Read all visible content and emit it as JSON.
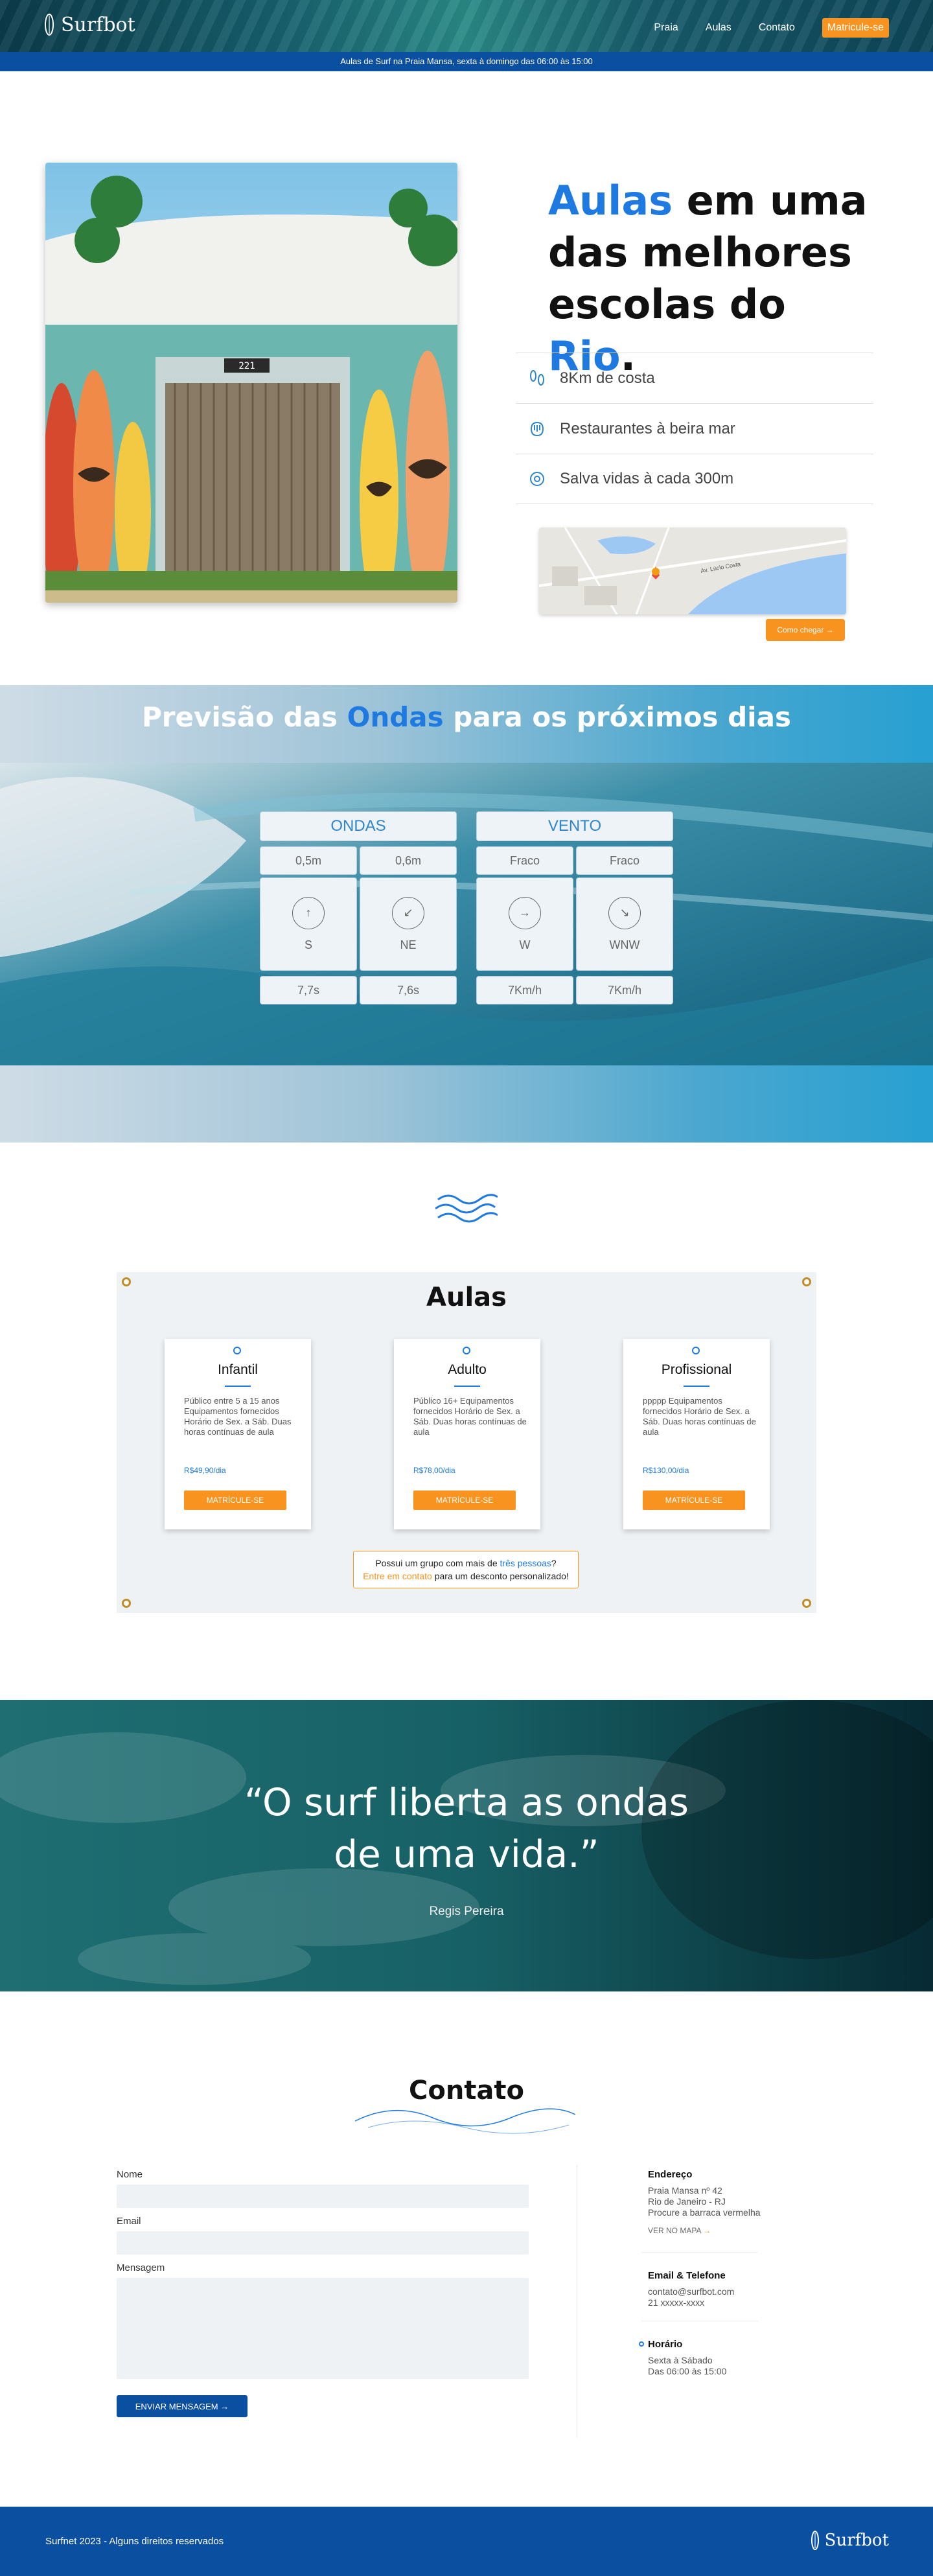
{
  "header": {
    "logo_text": "Surfbot",
    "nav": [
      "Praia",
      "Aulas",
      "Contato"
    ],
    "cta": "Matricule-se"
  },
  "topbar": {
    "text": "Aulas de Surf na Praia Mansa, sexta à domingo das 06:00 às 15:00"
  },
  "hero": {
    "title_part1": "Aulas",
    "title_part2": " em uma das melhores escolas do ",
    "title_part3": "Rio",
    "title_part4": ".",
    "house_number": "221",
    "features": [
      {
        "icon": "footprints-icon",
        "label": "8Km de costa"
      },
      {
        "icon": "food-icon",
        "label": "Restaurantes à beira mar"
      },
      {
        "icon": "lifebuoy-icon",
        "label": "Salva vidas à cada 300m"
      }
    ],
    "map_button": "Como chegar →",
    "map_street": "Av. Lúcio Costa"
  },
  "forecast": {
    "title_part1": "Previsão das ",
    "title_part2": "Ondas",
    "title_part3": " para os próximos dias",
    "ondas": {
      "title": "ONDAS",
      "heights": [
        "0,5m",
        "0,6m"
      ],
      "directions": [
        {
          "arrow": "↑",
          "label": "S"
        },
        {
          "arrow": "↙",
          "label": "NE"
        }
      ],
      "periods": [
        "7,7s",
        "7,6s"
      ]
    },
    "vento": {
      "title": "VENTO",
      "strengths": [
        "Fraco",
        "Fraco"
      ],
      "directions": [
        {
          "arrow": "→",
          "label": "W"
        },
        {
          "arrow": "↘",
          "label": "WNW"
        }
      ],
      "speeds": [
        "7Km/h",
        "7Km/h"
      ]
    }
  },
  "aulas": {
    "title": "Aulas",
    "cards": [
      {
        "title": "Infantil",
        "desc": "Público entre 5 a 15 anos Equipamentos fornecidos Horário de Sex. a Sáb. Duas horas contínuas de aula",
        "price": "R$49,90/dia",
        "button": "MATRÍCULE-SE"
      },
      {
        "title": "Adulto",
        "desc": "Público 16+ Equipamentos fornecidos Horário de Sex. a Sáb. Duas horas contínuas de aula",
        "price": "R$78,00/dia",
        "button": "MATRÍCULE-SE"
      },
      {
        "title": "Profissional",
        "desc": "ppppp Equipamentos fornecidos Horário de Sex. a Sáb. Duas horas contínuas de aula",
        "price": "R$130,00/dia",
        "button": "MATRÍCULE-SE"
      }
    ],
    "group_line1a": "Possui um grupo com mais de ",
    "group_line1b": "três pessoas",
    "group_line1c": "?",
    "group_line2a": "Entre em contato",
    "group_line2b": " para um desconto personalizado!"
  },
  "quote": {
    "line1": "“O surf liberta as ondas",
    "line2": "de uma vida.”",
    "author": "Regis Pereira"
  },
  "contato": {
    "title": "Contato",
    "fields": {
      "name": "Nome",
      "email": "Email",
      "message": "Mensagem"
    },
    "send_button": "ENVIAR MENSAGEM →",
    "address": {
      "title": "Endereço",
      "lines": [
        "Praia Mansa nº 42",
        "Rio de Janeiro - RJ",
        "Procure a barraca vermelha"
      ],
      "link": "VER NO MAPA",
      "link_arrow": "→"
    },
    "email_phone": {
      "title": "Email & Telefone",
      "lines": [
        "contato@surfbot.com",
        "21 xxxxx-xxxx"
      ]
    },
    "hours": {
      "title": "Horário",
      "lines": [
        "Sexta à Sábado",
        "Das 06:00 às 15:00"
      ]
    }
  },
  "footer": {
    "copy": "Surfnet 2023 -  Alguns direitos reservados",
    "logo_text": "Surfbot"
  },
  "colors": {
    "primary": "#0b4fa0",
    "accent": "#f7931e",
    "link": "#1e7ae0"
  }
}
